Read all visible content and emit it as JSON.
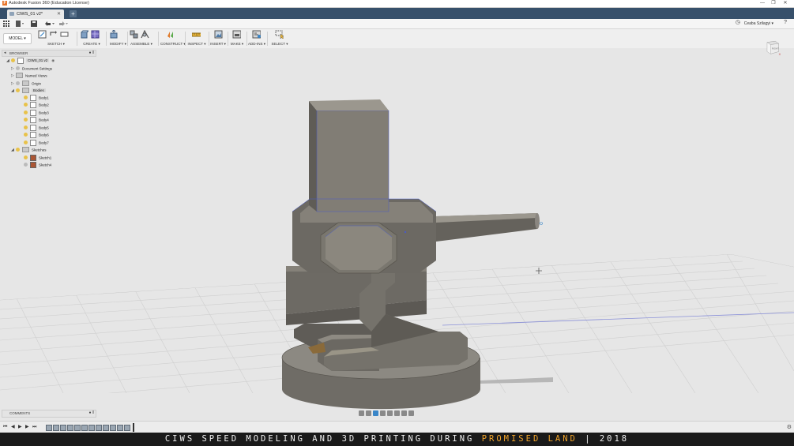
{
  "window": {
    "title": "Autodesk Fusion 360 (Education License)",
    "controls": [
      "—",
      "❐",
      "✕"
    ]
  },
  "tab": {
    "label": "CIWS_01 v2*",
    "close": "✕",
    "new": "+"
  },
  "quick_access": {
    "user": "Ceaba Szilagyi ▾",
    "help": "?",
    "clock": "◷"
  },
  "workspace": {
    "label": "MODEL ▾"
  },
  "toolbar": {
    "groups": [
      {
        "label": "SKETCH ▾",
        "icons": [
          "sketch-icon",
          "undo-sketch-icon",
          "rectangle-icon"
        ]
      },
      {
        "label": "CREATE ▾",
        "icons": [
          "extrude-icon",
          "box-icon"
        ]
      },
      {
        "label": "MODIFY ▾",
        "icons": [
          "press-pull-icon"
        ]
      },
      {
        "label": "ASSEMBLE ▾",
        "icons": [
          "joint-icon",
          "as-built-joint-icon"
        ]
      },
      {
        "label": "CONSTRUCT ▾",
        "icons": [
          "offset-plane-icon"
        ]
      },
      {
        "label": "INSPECT ▾",
        "icons": [
          "measure-icon"
        ]
      },
      {
        "label": "INSERT ▾",
        "icons": [
          "insert-image-icon"
        ]
      },
      {
        "label": "MAKE ▾",
        "icons": [
          "3d-print-icon"
        ]
      },
      {
        "label": "ADD-INS ▾",
        "icons": [
          "scripts-icon"
        ]
      },
      {
        "label": "SELECT ▾",
        "icons": [
          "select-icon"
        ]
      }
    ]
  },
  "browser": {
    "header": "BROWSER",
    "root": "CIWS_01 v2",
    "items": [
      {
        "label": "Document Settings"
      },
      {
        "label": "Named Views"
      },
      {
        "label": "Origin"
      },
      {
        "label": "Bodies"
      },
      {
        "label": "Body1"
      },
      {
        "label": "Body2"
      },
      {
        "label": "Body3"
      },
      {
        "label": "Body4"
      },
      {
        "label": "Body5"
      },
      {
        "label": "Body6"
      },
      {
        "label": "Body7"
      },
      {
        "label": "Sketches"
      },
      {
        "label": "Sketch1"
      },
      {
        "label": "Sketch4"
      }
    ]
  },
  "viewcube": {
    "face": "RIGHT"
  },
  "comments": {
    "label": "COMMENTS"
  },
  "caption": {
    "prefix": "CIWS SPEED MODELING AND 3D PRINTING DURING ",
    "highlight": "PROMISED LAND",
    "suffix": " | 2018"
  },
  "colors": {
    "title_tab_bg": "#37506b",
    "model_grey": "#7a776f",
    "accent_orange": "#f0a32a",
    "sketch_blue": "#4a5cc8"
  }
}
